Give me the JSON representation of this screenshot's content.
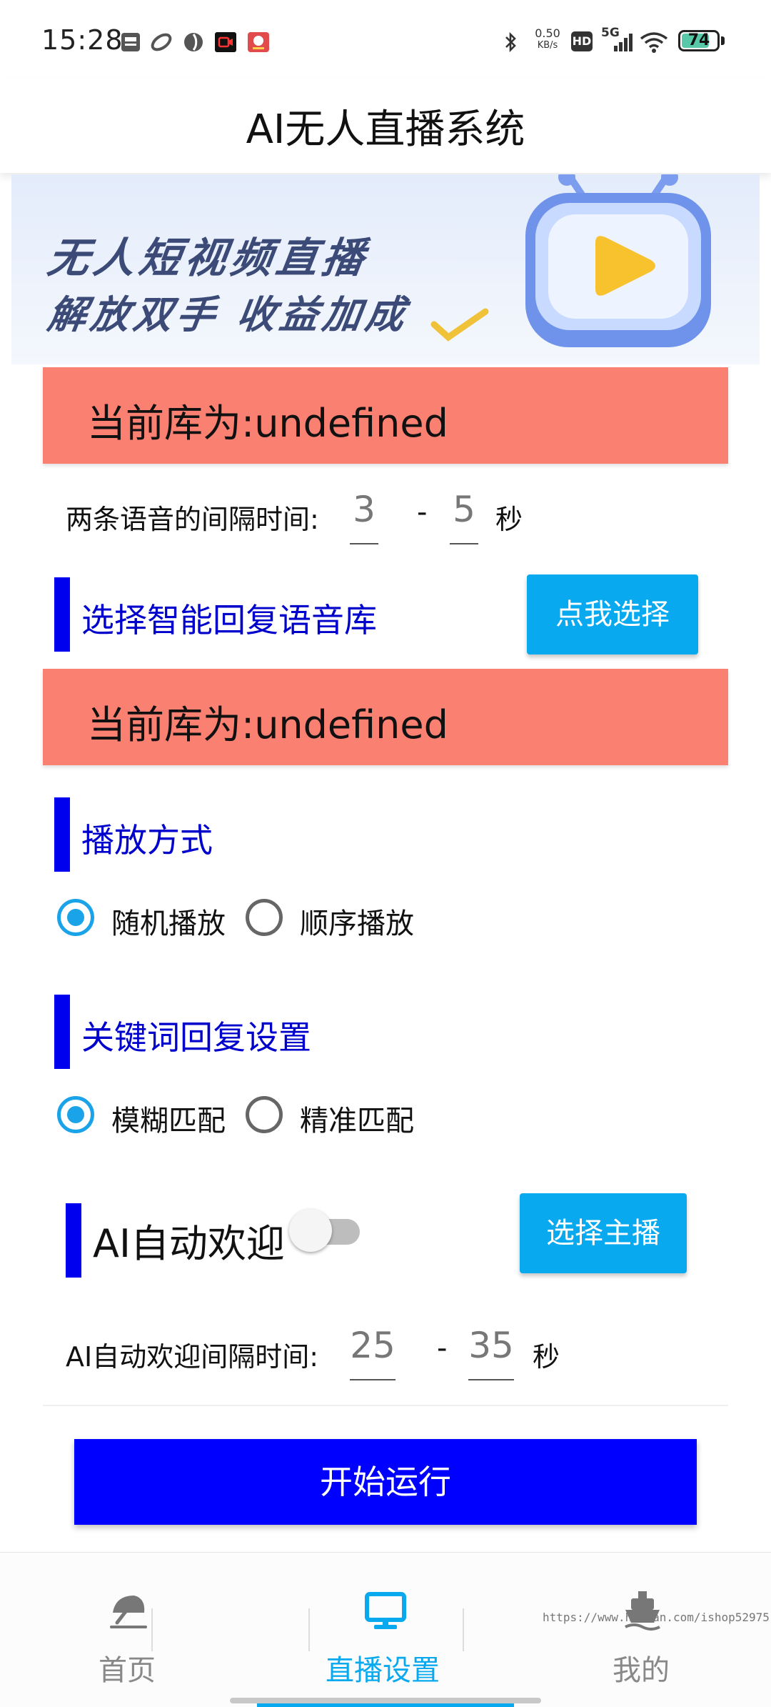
{
  "status_bar": {
    "time": "15:28",
    "net_speed_value": "0.50",
    "net_speed_unit": "KB/s",
    "hd_badge": "HD",
    "network": "5G",
    "battery": "74"
  },
  "header": {
    "title": "AI无人直播系统"
  },
  "banner": {
    "line1": "无人短视频直播",
    "line2": "解放双手 收益加成"
  },
  "voice_library": {
    "current_label": "当前库为:undefined"
  },
  "voice_interval": {
    "label": "两条语音的间隔时间:",
    "min": "3",
    "max": "5",
    "separator": "-",
    "unit": "秒"
  },
  "smart_reply": {
    "title": "选择智能回复语音库",
    "button_label": "点我选择",
    "current_label": "当前库为:undefined"
  },
  "play_mode": {
    "title": "播放方式",
    "options": [
      {
        "label": "随机播放",
        "selected": true
      },
      {
        "label": "顺序播放",
        "selected": false
      }
    ]
  },
  "keyword_reply": {
    "title": "关键词回复设置",
    "options": [
      {
        "label": "模糊匹配",
        "selected": true
      },
      {
        "label": "精准匹配",
        "selected": false
      }
    ]
  },
  "auto_welcome": {
    "title": "AI自动欢迎",
    "enabled": false,
    "button_label": "选择主播",
    "interval_label": "AI自动欢迎间隔时间:",
    "min": "25",
    "max": "35",
    "separator": "-",
    "unit": "秒"
  },
  "start_button_label": "开始运行",
  "bottom_nav": {
    "items": [
      {
        "label": "首页",
        "icon": "beach-umbrella-icon",
        "active": false
      },
      {
        "label": "直播设置",
        "icon": "monitor-icon",
        "active": true
      },
      {
        "label": "我的",
        "icon": "ship-icon",
        "active": false
      }
    ]
  },
  "watermark": "https://www.huzhan.com/ishop52975",
  "colors": {
    "accent": "#09a9ef",
    "library_bar": "#fa8072",
    "section_blue": "#0000ee",
    "start_button": "#0000ff"
  }
}
